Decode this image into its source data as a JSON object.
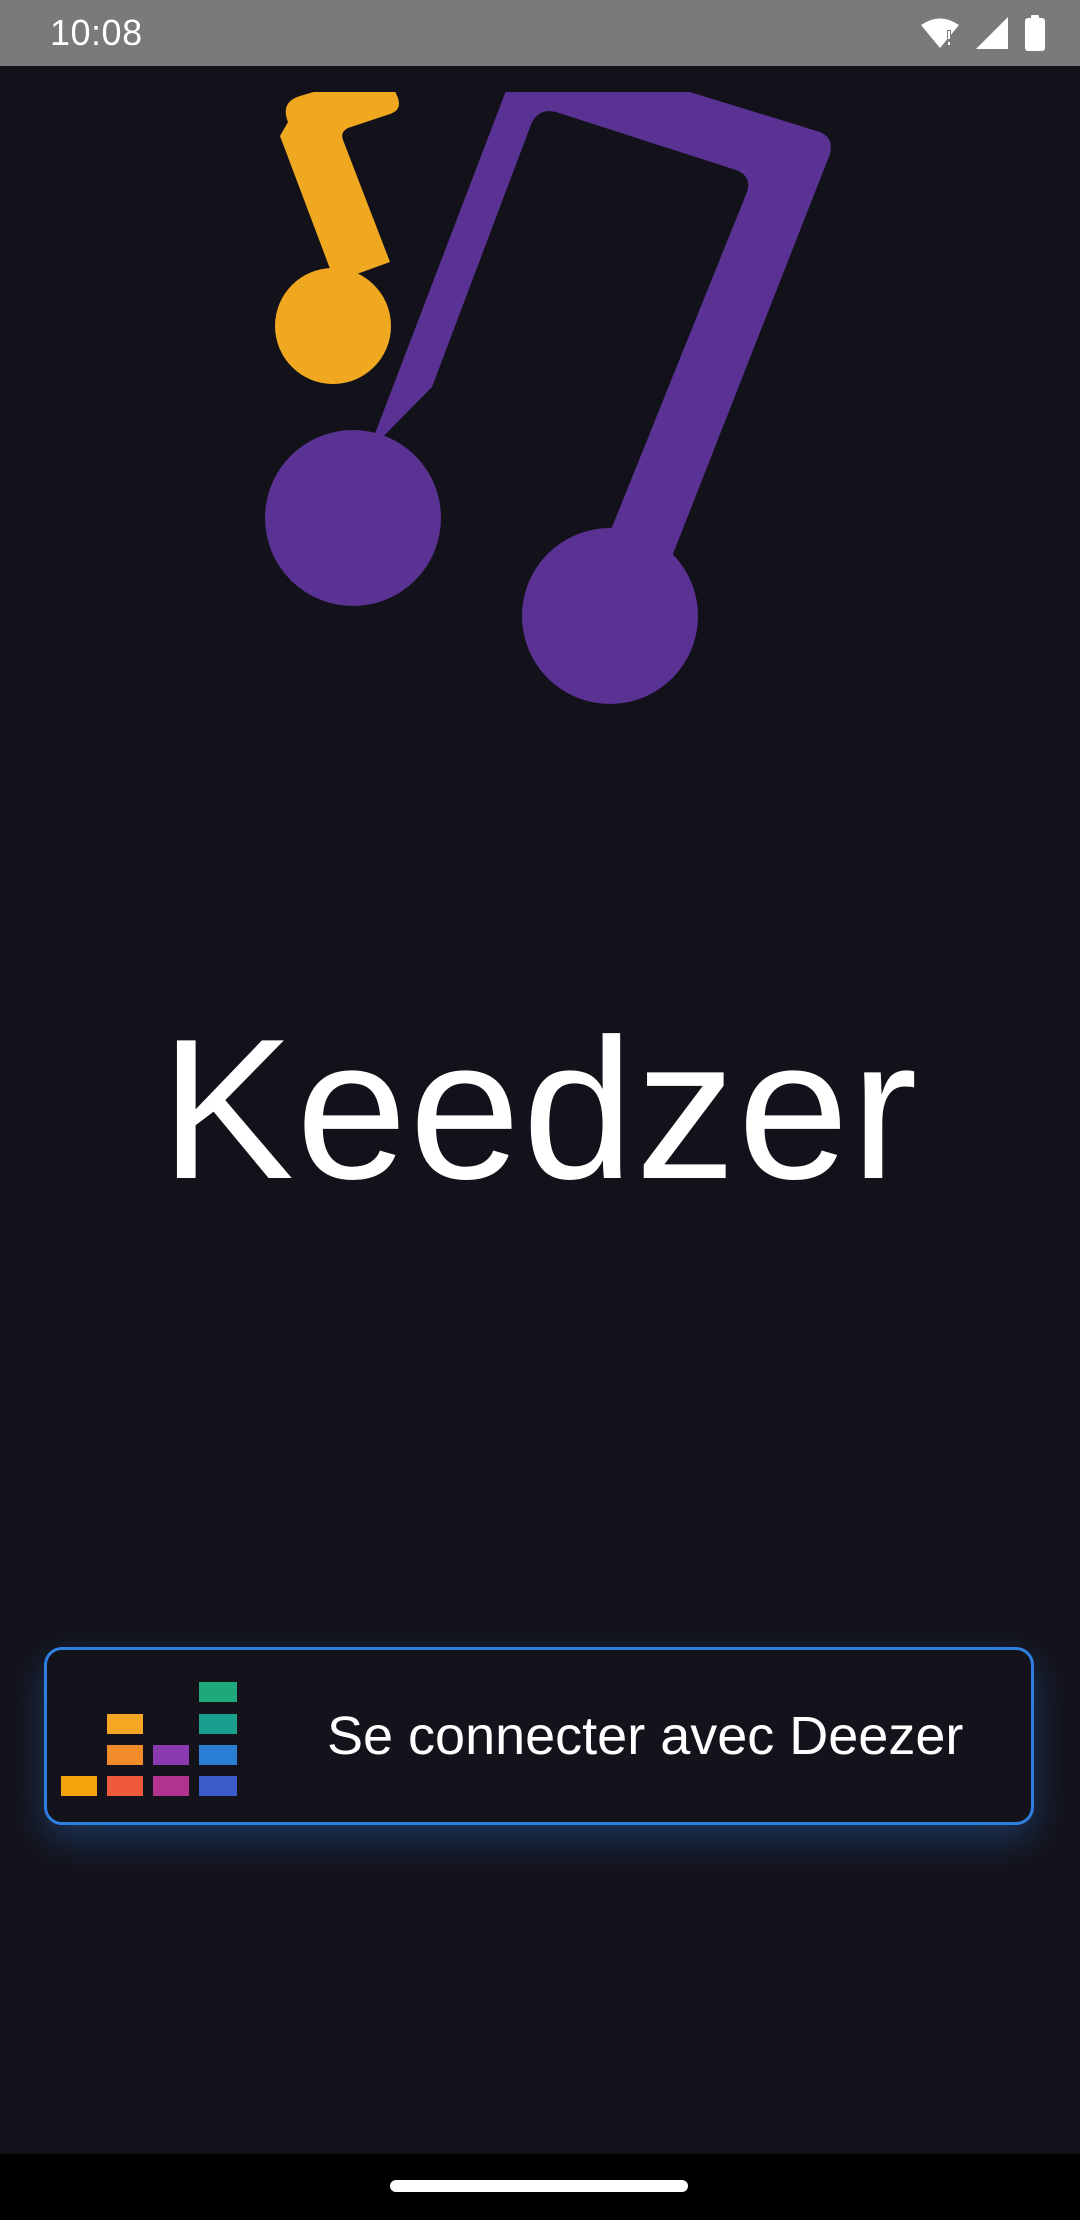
{
  "status_bar": {
    "time": "10:08",
    "icons": [
      "wifi-icon",
      "signal-icon",
      "battery-icon"
    ]
  },
  "logo": {
    "icon": "music-notes-logo-icon",
    "colors": {
      "small_note": "#f0a820",
      "large_note": "#5a3294"
    }
  },
  "app": {
    "title": "Keedzer"
  },
  "connect_button": {
    "label": "Se connecter avec Deezer",
    "icon": "deezer-logo-icon",
    "border_color": "#2f7fe0"
  },
  "colors": {
    "background": "#13121a",
    "status_bar": "#7a7a7a",
    "nav_bar": "#000000"
  }
}
